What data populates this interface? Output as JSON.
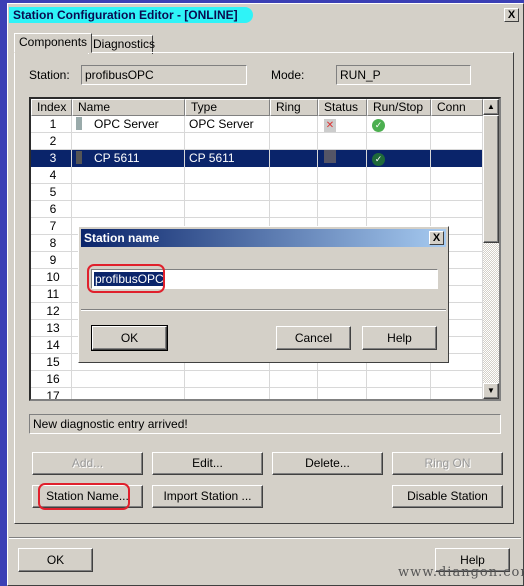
{
  "window": {
    "title": "Station Configuration Editor - [ONLINE]",
    "close": "X"
  },
  "tabs": [
    {
      "label": "Components"
    },
    {
      "label": "Diagnostics"
    }
  ],
  "station": {
    "label": "Station:",
    "value": "profibusOPC"
  },
  "mode": {
    "label": "Mode:",
    "value": "RUN_P"
  },
  "table": {
    "columns": [
      "Index",
      "Name",
      "Type",
      "Ring",
      "Status",
      "Run/Stop",
      "Conn"
    ],
    "rows": [
      {
        "index": "1",
        "name": "OPC Server",
        "type": "OPC Server",
        "status_icon": "disconnected-icon",
        "run_icon": "check-icon"
      },
      {
        "index": "2"
      },
      {
        "index": "3",
        "name": "CP 5611",
        "type": "CP 5611",
        "status_icon": "network-icon",
        "run_icon": "check-icon",
        "selected": true
      },
      {
        "index": "4"
      },
      {
        "index": "5"
      },
      {
        "index": "6"
      },
      {
        "index": "7"
      },
      {
        "index": "8"
      },
      {
        "index": "9"
      },
      {
        "index": "10"
      },
      {
        "index": "11"
      },
      {
        "index": "12"
      },
      {
        "index": "13"
      },
      {
        "index": "14"
      },
      {
        "index": "15"
      },
      {
        "index": "16"
      },
      {
        "index": "17"
      }
    ]
  },
  "status_message": "New diagnostic entry arrived!",
  "buttons": {
    "add": "Add...",
    "edit": "Edit...",
    "delete": "Delete...",
    "ring_on": "Ring ON",
    "station_name": "Station Name...",
    "import_station": "Import Station ...",
    "disable_station": "Disable Station",
    "ok": "OK",
    "help": "Help"
  },
  "dialog": {
    "title": "Station name",
    "close": "X",
    "input_value": "profibusOPC",
    "ok": "OK",
    "cancel": "Cancel",
    "help": "Help"
  },
  "watermark": "www.diangon.com",
  "colors": {
    "selection": "#0a246a",
    "highlight": "#e0202c",
    "title_highlight": "#2ff3f7"
  }
}
